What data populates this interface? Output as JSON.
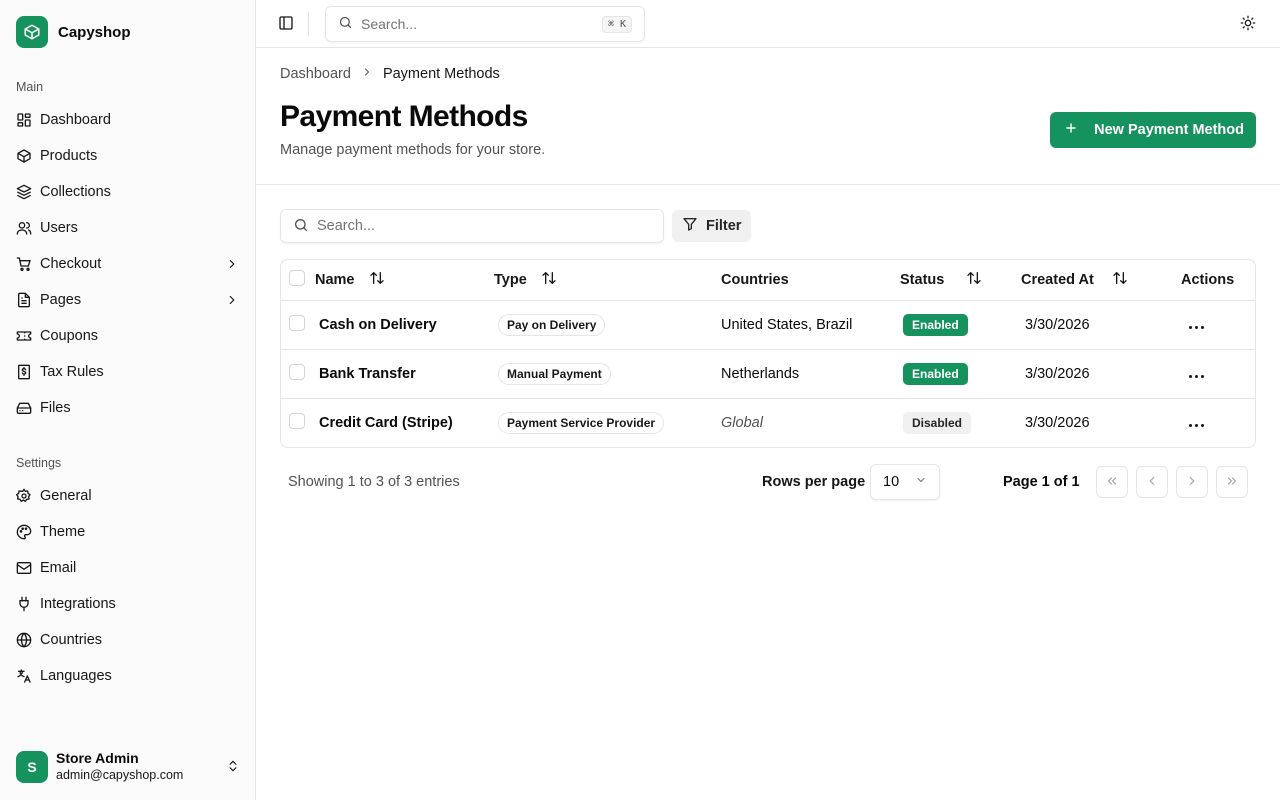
{
  "app": {
    "name": "Capyshop"
  },
  "colors": {
    "accent": "#16925f",
    "border": "#e5e5e5"
  },
  "sidebar": {
    "groups": [
      {
        "label": "Main",
        "items": [
          {
            "label": "Dashboard",
            "icon": "dashboard-icon"
          },
          {
            "label": "Products",
            "icon": "package-icon"
          },
          {
            "label": "Collections",
            "icon": "layers-icon"
          },
          {
            "label": "Users",
            "icon": "users-icon"
          },
          {
            "label": "Checkout",
            "icon": "cart-icon",
            "has_children": true
          },
          {
            "label": "Pages",
            "icon": "file-icon",
            "has_children": true
          },
          {
            "label": "Coupons",
            "icon": "ticket-icon"
          },
          {
            "label": "Tax Rules",
            "icon": "receipt-icon"
          },
          {
            "label": "Files",
            "icon": "hard-drive-icon"
          }
        ]
      },
      {
        "label": "Settings",
        "items": [
          {
            "label": "General",
            "icon": "gear-icon"
          },
          {
            "label": "Theme",
            "icon": "palette-icon"
          },
          {
            "label": "Email",
            "icon": "mail-icon"
          },
          {
            "label": "Integrations",
            "icon": "plug-icon"
          },
          {
            "label": "Countries",
            "icon": "globe-icon"
          },
          {
            "label": "Languages",
            "icon": "languages-icon"
          }
        ]
      }
    ],
    "user": {
      "initial": "S",
      "name": "Store Admin",
      "email": "admin@capyshop.com"
    }
  },
  "topbar": {
    "search_placeholder": "Search...",
    "shortcut": "⌘ K"
  },
  "breadcrumb": {
    "parent": "Dashboard",
    "current": "Payment Methods"
  },
  "page": {
    "title": "Payment Methods",
    "subtitle": "Manage payment methods for your store.",
    "new_button_label": "New Payment Method"
  },
  "table": {
    "search_placeholder": "Search...",
    "filter_label": "Filter",
    "columns": {
      "name": "Name",
      "type": "Type",
      "countries": "Countries",
      "status": "Status",
      "created_at": "Created At",
      "actions": "Actions"
    },
    "rows": [
      {
        "name": "Cash on Delivery",
        "type": "Pay on Delivery",
        "countries": "United States, Brazil",
        "countries_global": false,
        "status": "Enabled",
        "created_at": "3/30/2026"
      },
      {
        "name": "Bank Transfer",
        "type": "Manual Payment",
        "countries": "Netherlands",
        "countries_global": false,
        "status": "Enabled",
        "created_at": "3/30/2026"
      },
      {
        "name": "Credit Card (Stripe)",
        "type": "Payment Service Provider",
        "countries": "Global",
        "countries_global": true,
        "status": "Disabled",
        "created_at": "3/30/2026"
      }
    ]
  },
  "pagination": {
    "showing": "Showing 1 to 3 of 3 entries",
    "rows_per_page_label": "Rows per page",
    "rows_per_page_value": "10",
    "page_label": "Page 1 of 1"
  }
}
